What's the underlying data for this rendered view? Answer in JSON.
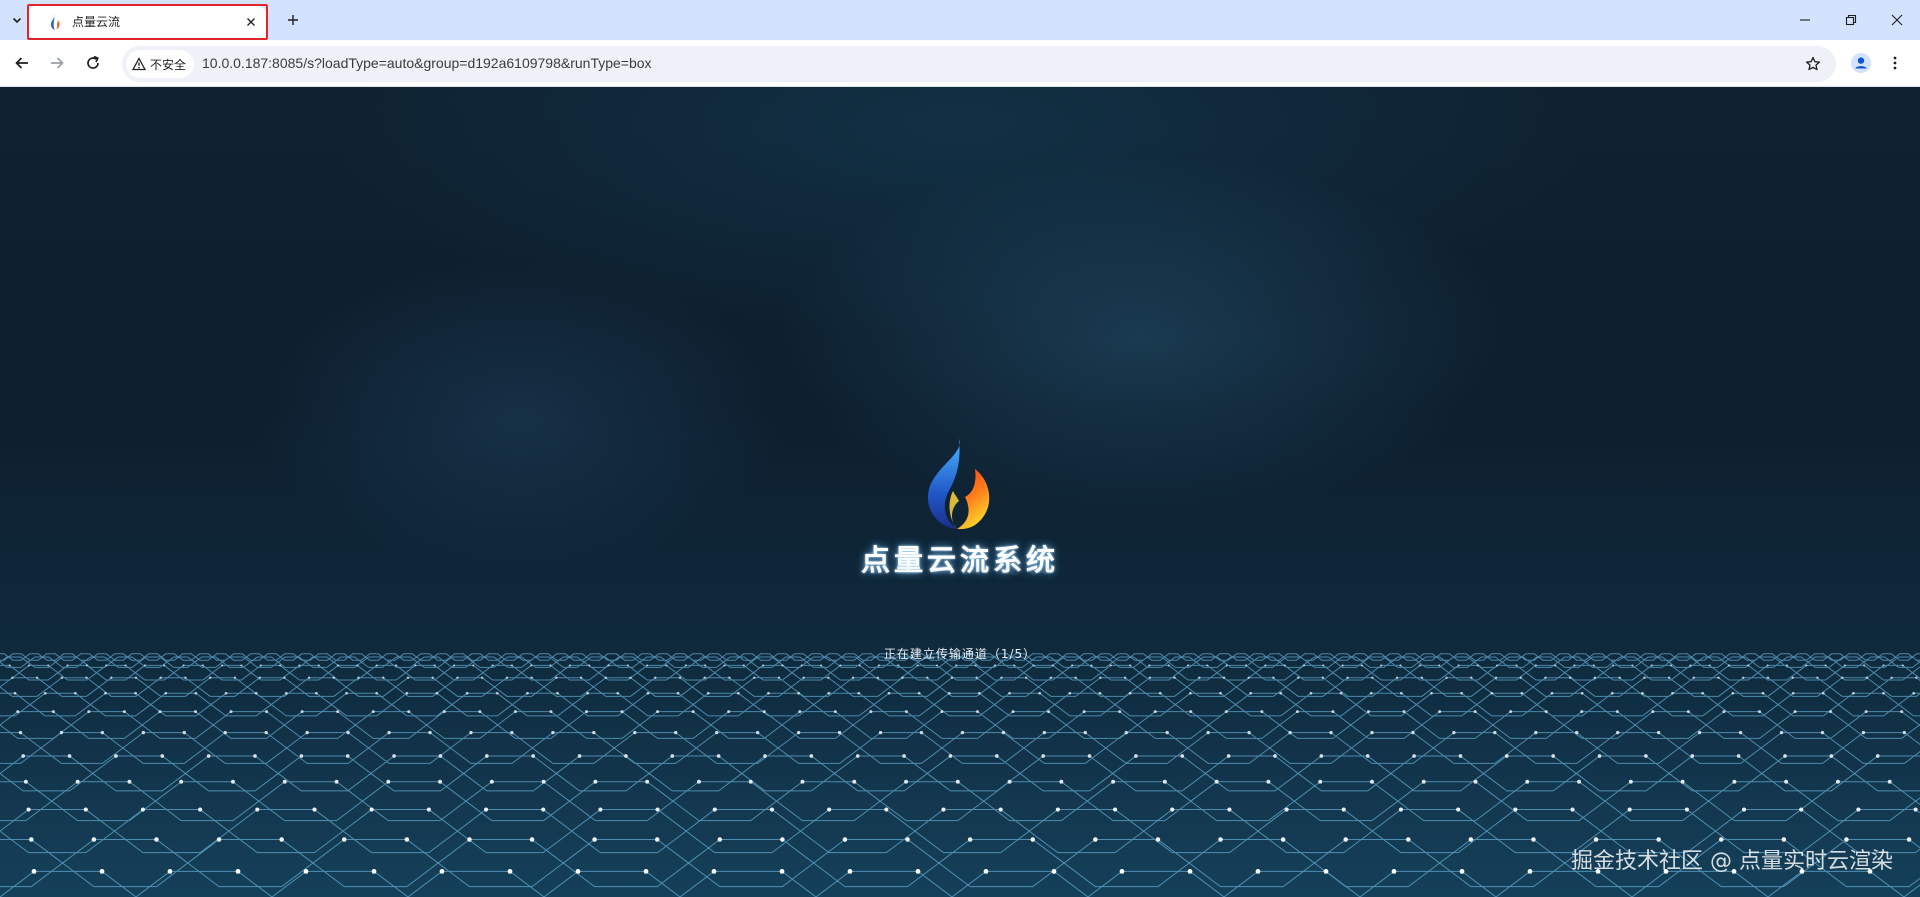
{
  "browser": {
    "tab": {
      "title": "点量云流",
      "favicon": "flame-logo-icon"
    },
    "new_tab_label": "+",
    "window_controls": [
      "minimize-icon",
      "restore-icon",
      "close-icon"
    ],
    "security_label": "不安全",
    "url": "10.0.0.187:8085/s?loadType=auto&group=d192a6109798&runType=box",
    "tab_highlight_color": "#e0262b",
    "tabstrip_color": "#d3e3fd"
  },
  "page": {
    "app_title": "点量云流系统",
    "status": "正在建立传输通道（1/5）",
    "watermark": "掘金技术社区 @ 点量实时云渲染",
    "colors": {
      "background": "#0d1f2e",
      "mesh": "#7fd3ff"
    }
  }
}
